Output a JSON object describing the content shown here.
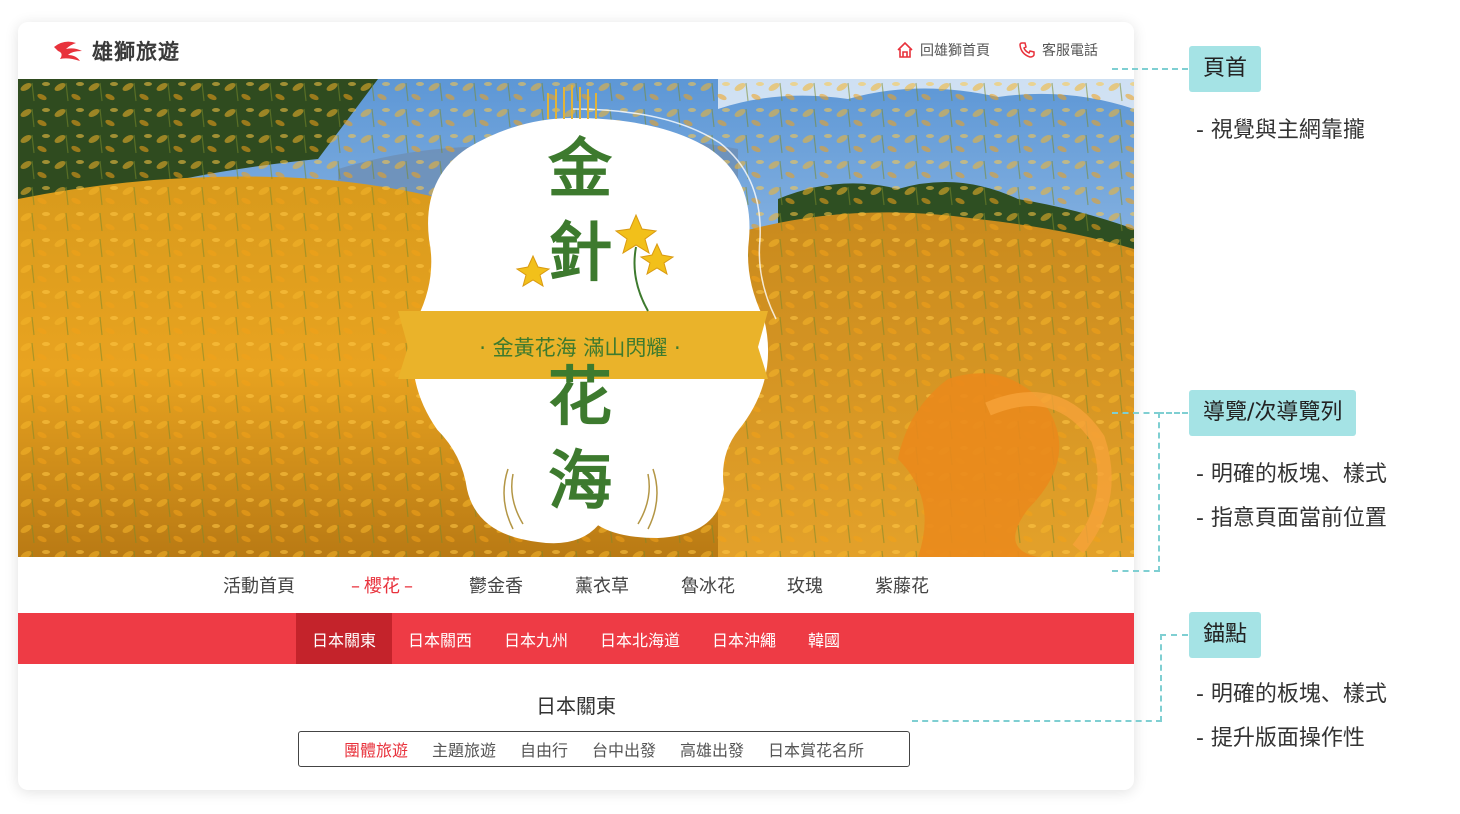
{
  "header": {
    "brand": "雄獅旅遊",
    "links": [
      {
        "label": "回雄獅首頁",
        "icon": "home-icon"
      },
      {
        "label": "客服電話",
        "icon": "phone-icon"
      }
    ]
  },
  "hero": {
    "title_chars": [
      "金",
      "針",
      "花",
      "海"
    ],
    "ribbon": "· 金黃花海  滿山閃耀 ·"
  },
  "nav": {
    "items": [
      "活動首頁",
      "櫻花",
      "鬱金香",
      "薰衣草",
      "魯冰花",
      "玫瑰",
      "紫藤花"
    ],
    "active": "櫻花"
  },
  "subnav": {
    "items": [
      "日本關東",
      "日本關西",
      "日本九州",
      "日本北海道",
      "日本沖繩",
      "韓國"
    ],
    "active": "日本關東"
  },
  "section": {
    "title": "日本關東",
    "anchors": [
      "團體旅遊",
      "主題旅遊",
      "自由行",
      "台中出發",
      "高雄出發",
      "日本賞花名所"
    ],
    "active": "團體旅遊"
  },
  "annotations": [
    {
      "tag": "頁首",
      "notes": [
        "- 視覺與主網靠攏"
      ]
    },
    {
      "tag": "導覽/次導覽列",
      "notes": [
        "- 明確的板塊、樣式",
        "- 指意頁面當前位置"
      ]
    },
    {
      "tag": "錨點",
      "notes": [
        "- 明確的板塊、樣式",
        "- 提升版面操作性"
      ]
    }
  ],
  "colors": {
    "brand_red": "#ee3b45",
    "active_red": "#c4232b",
    "accent_teal": "#a5e3e5",
    "title_green": "#3d7a2e",
    "ribbon_gold": "#eab32a"
  }
}
